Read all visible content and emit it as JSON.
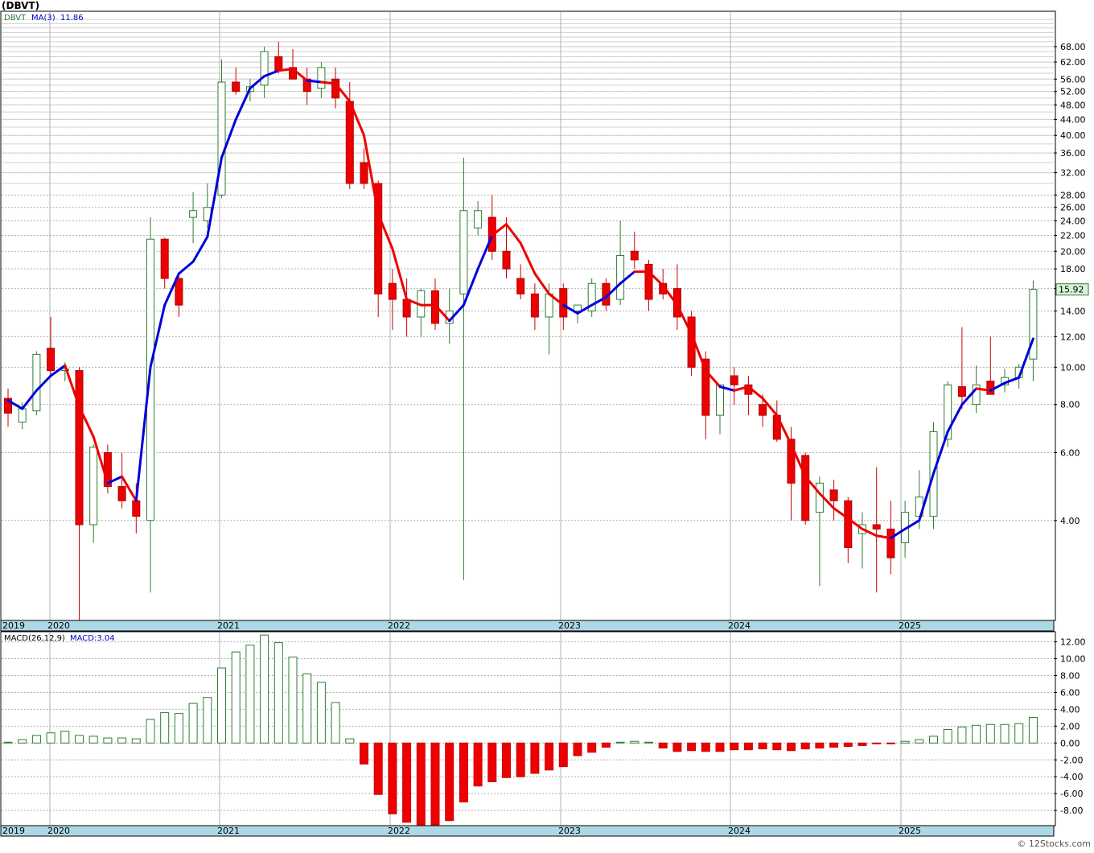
{
  "symbol_title": "(DBVT)",
  "watermark": "© 12Stocks.com",
  "price_panel": {
    "symbol_label": "DBVT",
    "ma_label": "MA(3)",
    "ma_value": "11.86",
    "last_price_label": "15.92",
    "last_price": 15.92,
    "y_ticks": [
      "4.00",
      "6.00",
      "8.00",
      "10.00",
      "12.00",
      "14.00",
      "16.00",
      "18.00",
      "20.00",
      "22.00",
      "24.00",
      "26.00",
      "28.00",
      "32.00",
      "36.00",
      "40.00",
      "44.00",
      "48.00",
      "52.00",
      "56.00",
      "62.00",
      "68.00"
    ],
    "scale": "log"
  },
  "macd_panel": {
    "label": "MACD(26,12,9)",
    "macd_label": "MACD:3.04",
    "y_ticks": [
      "12.00",
      "10.00",
      "8.00",
      "6.00",
      "4.00",
      "2.00",
      "0.00",
      "-2.00",
      "-4.00",
      "-6.00",
      "-8.00"
    ]
  },
  "years": [
    "2019",
    "2020",
    "2021",
    "2022",
    "2023",
    "2024",
    "2025"
  ],
  "colors": {
    "up_candle_stroke": "#2e7d32",
    "down_candle_fill": "#ee0000",
    "ma_up": "#0000dd",
    "ma_down": "#ee0000",
    "grid": "#b0b0b0",
    "axis_band": "#add8e6",
    "price_box_bg": "#d9f2d9"
  },
  "chart_data": [
    {
      "type": "candlestick",
      "title": "(DBVT)",
      "x_start": "2019-12",
      "ylim": [
        2.2,
        84
      ],
      "ohlc": [
        [
          8.3,
          8.8,
          7.0,
          7.6
        ],
        [
          7.2,
          8.1,
          6.9,
          7.8
        ],
        [
          7.7,
          11.0,
          7.5,
          10.8
        ],
        [
          11.2,
          13.5,
          9.5,
          9.8
        ],
        [
          9.8,
          10.3,
          9.2,
          9.9
        ],
        [
          9.8,
          10.0,
          2.2,
          3.9
        ],
        [
          3.9,
          6.3,
          3.5,
          6.2
        ],
        [
          6.0,
          6.3,
          4.7,
          4.9
        ],
        [
          4.9,
          6.0,
          4.3,
          4.5
        ],
        [
          4.5,
          5.0,
          3.7,
          4.1
        ],
        [
          4.0,
          24.5,
          2.6,
          21.5
        ],
        [
          21.5,
          21.7,
          16.0,
          17.0
        ],
        [
          17.0,
          17.2,
          13.5,
          14.5
        ],
        [
          24.5,
          28.5,
          21.0,
          25.5
        ],
        [
          24.0,
          30.0,
          23.0,
          26.0
        ],
        [
          28.0,
          63.0,
          27.5,
          55.0
        ],
        [
          55.0,
          60.0,
          51.0,
          52.0
        ],
        [
          52.0,
          56.0,
          49.0,
          53.5
        ],
        [
          54.0,
          68.0,
          50.0,
          66.0
        ],
        [
          64.0,
          70.0,
          58.0,
          59.0
        ],
        [
          60.0,
          67.0,
          57.0,
          56.0
        ],
        [
          56.0,
          60.0,
          48.0,
          52.0
        ],
        [
          53.0,
          62.0,
          50.0,
          60.0
        ],
        [
          56.0,
          60.0,
          47.0,
          50.0
        ],
        [
          49.0,
          55.0,
          29.0,
          30.0
        ],
        [
          34.0,
          37.0,
          29.0,
          30.0
        ],
        [
          30.0,
          30.5,
          13.5,
          15.5
        ],
        [
          16.5,
          18.0,
          12.5,
          15.0
        ],
        [
          15.0,
          17.0,
          12.0,
          13.5
        ],
        [
          13.5,
          16.0,
          12.0,
          15.8
        ],
        [
          15.8,
          17.0,
          12.5,
          13.0
        ],
        [
          13.0,
          16.0,
          11.5,
          14.0
        ],
        [
          15.5,
          35.0,
          2.8,
          25.5
        ],
        [
          23.0,
          27.0,
          22.0,
          25.5
        ],
        [
          24.5,
          28.0,
          19.0,
          20.0
        ],
        [
          20.0,
          24.5,
          17.0,
          18.0
        ],
        [
          17.0,
          18.5,
          15.0,
          15.5
        ],
        [
          15.5,
          16.5,
          12.5,
          13.5
        ],
        [
          13.5,
          16.5,
          10.8,
          15.5
        ],
        [
          16.0,
          16.5,
          12.5,
          13.5
        ],
        [
          14.0,
          14.5,
          13.0,
          14.5
        ],
        [
          14.0,
          17.0,
          13.5,
          16.5
        ],
        [
          16.5,
          17.0,
          14.0,
          14.5
        ],
        [
          15.0,
          24.0,
          14.5,
          19.5
        ],
        [
          20.0,
          22.5,
          18.0,
          19.0
        ],
        [
          18.5,
          19.0,
          14.0,
          15.0
        ],
        [
          16.5,
          18.0,
          15.0,
          15.5
        ],
        [
          16.0,
          18.5,
          12.5,
          13.5
        ],
        [
          13.5,
          14.0,
          9.5,
          10.0
        ],
        [
          10.5,
          11.0,
          6.5,
          7.5
        ],
        [
          7.5,
          9.0,
          6.7,
          9.0
        ],
        [
          9.5,
          10.0,
          8.0,
          9.0
        ],
        [
          9.0,
          9.5,
          7.5,
          8.5
        ],
        [
          8.0,
          8.5,
          7.0,
          7.5
        ],
        [
          7.5,
          8.2,
          6.4,
          6.5
        ],
        [
          6.5,
          7.0,
          4.0,
          5.0
        ],
        [
          5.9,
          6.0,
          3.9,
          4.0
        ],
        [
          4.2,
          5.2,
          2.7,
          5.0
        ],
        [
          4.8,
          5.1,
          4.0,
          4.5
        ],
        [
          4.5,
          4.6,
          3.1,
          3.4
        ],
        [
          3.7,
          4.2,
          3.0,
          3.9
        ],
        [
          3.9,
          5.5,
          2.6,
          3.8
        ],
        [
          3.8,
          4.5,
          2.9,
          3.2
        ],
        [
          3.5,
          4.5,
          3.2,
          4.2
        ],
        [
          4.1,
          5.4,
          3.8,
          4.6
        ],
        [
          4.1,
          7.2,
          3.8,
          6.8
        ],
        [
          6.5,
          9.2,
          6.2,
          9.0
        ],
        [
          8.9,
          12.7,
          7.8,
          8.4
        ],
        [
          8.0,
          10.1,
          7.6,
          9.0
        ],
        [
          9.2,
          12.0,
          8.5,
          8.5
        ],
        [
          9.0,
          9.9,
          8.6,
          9.4
        ],
        [
          9.4,
          10.2,
          8.8,
          10.0
        ],
        [
          10.5,
          16.8,
          9.2,
          15.92
        ]
      ],
      "ma3": [
        8.2,
        7.8,
        8.7,
        9.5,
        10.1,
        7.9,
        6.6,
        5.0,
        5.2,
        4.5,
        10.0,
        14.5,
        17.5,
        18.8,
        21.8,
        35.0,
        44.0,
        53.0,
        57.0,
        58.9,
        59.5,
        55.5,
        55.0,
        54.5,
        49.0,
        40.0,
        25.0,
        20.3,
        15.0,
        14.5,
        14.5,
        13.2,
        14.5,
        18.0,
        22.0,
        23.5,
        21.0,
        17.5,
        15.5,
        14.5,
        13.8,
        14.5,
        15.2,
        16.5,
        17.7,
        17.7,
        16.3,
        14.5,
        12.2,
        9.8,
        8.9,
        8.7,
        8.9,
        8.3,
        7.5,
        6.3,
        5.2,
        4.7,
        4.3,
        4.05,
        3.8,
        3.65,
        3.6,
        3.8,
        4.0,
        5.3,
        6.8,
        8.0,
        8.8,
        8.7,
        9.1,
        9.4,
        11.86
      ],
      "ma3_color": [
        "blue",
        "blue",
        "blue",
        "blue",
        "blue",
        "red",
        "red",
        "red",
        "blue",
        "red",
        "blue",
        "blue",
        "blue",
        "blue",
        "blue",
        "blue",
        "blue",
        "blue",
        "blue",
        "blue",
        "red",
        "red",
        "blue",
        "red",
        "red",
        "red",
        "red",
        "red",
        "red",
        "red",
        "red",
        "red",
        "blue",
        "blue",
        "blue",
        "red",
        "red",
        "red",
        "red",
        "red",
        "blue",
        "blue",
        "blue",
        "blue",
        "blue",
        "red",
        "red",
        "red",
        "red",
        "red",
        "red",
        "blue",
        "red",
        "red",
        "red",
        "red",
        "red",
        "red",
        "red",
        "red",
        "red",
        "red",
        "red",
        "blue",
        "blue",
        "blue",
        "blue",
        "blue",
        "blue",
        "red",
        "blue",
        "blue",
        "blue"
      ]
    },
    {
      "type": "bar",
      "title": "MACD(26,12,9)",
      "ylim": [
        -9.8,
        13.2
      ],
      "values": [
        0.1,
        0.4,
        0.9,
        1.2,
        1.4,
        0.9,
        0.8,
        0.6,
        0.6,
        0.5,
        2.8,
        3.6,
        3.5,
        4.7,
        5.4,
        8.9,
        10.8,
        11.6,
        12.8,
        11.9,
        10.2,
        8.2,
        7.2,
        4.8,
        0.5,
        -2.5,
        -6.1,
        -8.4,
        -9.4,
        -9.7,
        -9.7,
        -9.2,
        -7.0,
        -5.1,
        -4.6,
        -4.1,
        -4.0,
        -3.6,
        -3.2,
        -2.8,
        -1.5,
        -1.1,
        -0.5,
        0.1,
        0.2,
        0.1,
        -0.6,
        -1.0,
        -0.9,
        -1.0,
        -1.0,
        -0.8,
        -0.8,
        -0.7,
        -0.8,
        -0.9,
        -0.7,
        -0.6,
        -0.5,
        -0.4,
        -0.3,
        -0.1,
        -0.1,
        0.2,
        0.4,
        0.8,
        1.6,
        1.9,
        2.1,
        2.2,
        2.2,
        2.3,
        3.04
      ]
    }
  ]
}
